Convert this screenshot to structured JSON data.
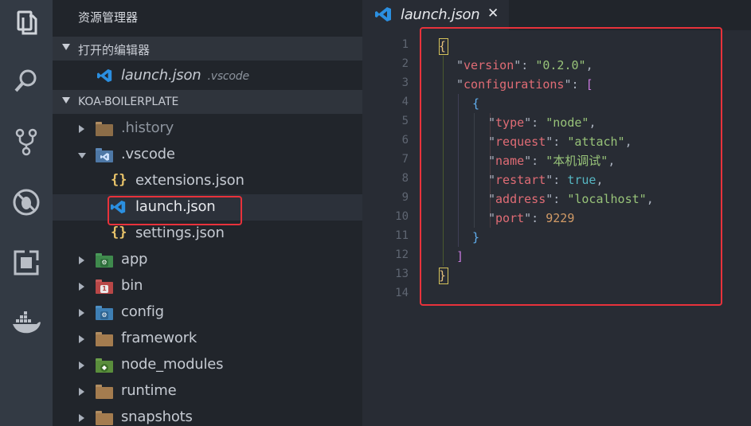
{
  "activity_bar": {
    "items": [
      {
        "icon": "files-icon"
      },
      {
        "icon": "search-icon"
      },
      {
        "icon": "source-control-icon"
      },
      {
        "icon": "debug-icon"
      },
      {
        "icon": "extensions-icon"
      },
      {
        "icon": "docker-icon"
      }
    ]
  },
  "sidebar": {
    "title": "资源管理器",
    "open_editors": {
      "label": "打开的编辑器",
      "items": [
        {
          "name": "launch.json",
          "folder": ".vscode"
        }
      ]
    },
    "project": {
      "label": "KOA-BOILERPLATE",
      "tree": [
        {
          "name": ".history",
          "kind": "folder",
          "expanded": false,
          "dim": true
        },
        {
          "name": ".vscode",
          "kind": "folder-vscode",
          "expanded": true
        },
        {
          "name": "extensions.json",
          "kind": "json-file"
        },
        {
          "name": "launch.json",
          "kind": "launch-file",
          "selected": true
        },
        {
          "name": "settings.json",
          "kind": "json-file"
        },
        {
          "name": "app",
          "kind": "folder-app",
          "expanded": false
        },
        {
          "name": "bin",
          "kind": "folder-bin",
          "expanded": false
        },
        {
          "name": "config",
          "kind": "folder-config",
          "expanded": false
        },
        {
          "name": "framework",
          "kind": "folder",
          "expanded": false
        },
        {
          "name": "node_modules",
          "kind": "folder-node",
          "expanded": false
        },
        {
          "name": "runtime",
          "kind": "folder",
          "expanded": false
        },
        {
          "name": "snapshots",
          "kind": "folder",
          "expanded": false
        }
      ]
    }
  },
  "editor": {
    "tab": {
      "label": "launch.json",
      "close": "✕"
    },
    "line_numbers": [
      "1",
      "2",
      "3",
      "4",
      "5",
      "6",
      "7",
      "8",
      "9",
      "10",
      "11",
      "12",
      "13",
      "14"
    ],
    "lines": [
      {
        "tokens": [
          [
            "brace-y",
            "{"
          ]
        ]
      },
      {
        "tokens": [
          [
            "q",
            "\""
          ],
          [
            "k",
            "version"
          ],
          [
            "q",
            "\": "
          ],
          [
            "s",
            "\"0.2.0\""
          ],
          [
            "q",
            ","
          ]
        ],
        "raw_indent": 1
      },
      {
        "tokens": [
          [
            "q",
            "\""
          ],
          [
            "k",
            "configurations"
          ],
          [
            "q",
            "\": "
          ],
          [
            "brack",
            "["
          ]
        ],
        "raw_indent": 1
      },
      {
        "tokens": [
          [
            "brace-b",
            "{"
          ]
        ],
        "raw_indent": 2
      },
      {
        "tokens": [
          [
            "q",
            "\""
          ],
          [
            "k",
            "type"
          ],
          [
            "q",
            "\": "
          ],
          [
            "s",
            "\"node\""
          ],
          [
            "q",
            ","
          ]
        ],
        "raw_indent": 3
      },
      {
        "tokens": [
          [
            "q",
            "\""
          ],
          [
            "k",
            "request"
          ],
          [
            "q",
            "\": "
          ],
          [
            "s",
            "\"attach\""
          ],
          [
            "q",
            ","
          ]
        ],
        "raw_indent": 3
      },
      {
        "tokens": [
          [
            "q",
            "\""
          ],
          [
            "k",
            "name"
          ],
          [
            "q",
            "\": "
          ],
          [
            "s",
            "\"本机调试\""
          ],
          [
            "q",
            ","
          ]
        ],
        "raw_indent": 3
      },
      {
        "tokens": [
          [
            "q",
            "\""
          ],
          [
            "k",
            "restart"
          ],
          [
            "q",
            "\": "
          ],
          [
            "v",
            "true"
          ],
          [
            "q",
            ","
          ]
        ],
        "raw_indent": 3
      },
      {
        "tokens": [
          [
            "q",
            "\""
          ],
          [
            "k",
            "address"
          ],
          [
            "q",
            "\": "
          ],
          [
            "s",
            "\"localhost\""
          ],
          [
            "q",
            ","
          ]
        ],
        "raw_indent": 3
      },
      {
        "tokens": [
          [
            "q",
            "\""
          ],
          [
            "k",
            "port"
          ],
          [
            "q",
            "\": "
          ],
          [
            "n",
            "9229"
          ]
        ],
        "raw_indent": 3
      },
      {
        "tokens": [
          [
            "brace-b",
            "}"
          ]
        ],
        "raw_indent": 2
      },
      {
        "tokens": [
          [
            "brack",
            "]"
          ]
        ],
        "raw_indent": 1
      },
      {
        "tokens": [
          [
            "brace-y",
            "}"
          ]
        ]
      },
      {
        "tokens": []
      }
    ]
  }
}
